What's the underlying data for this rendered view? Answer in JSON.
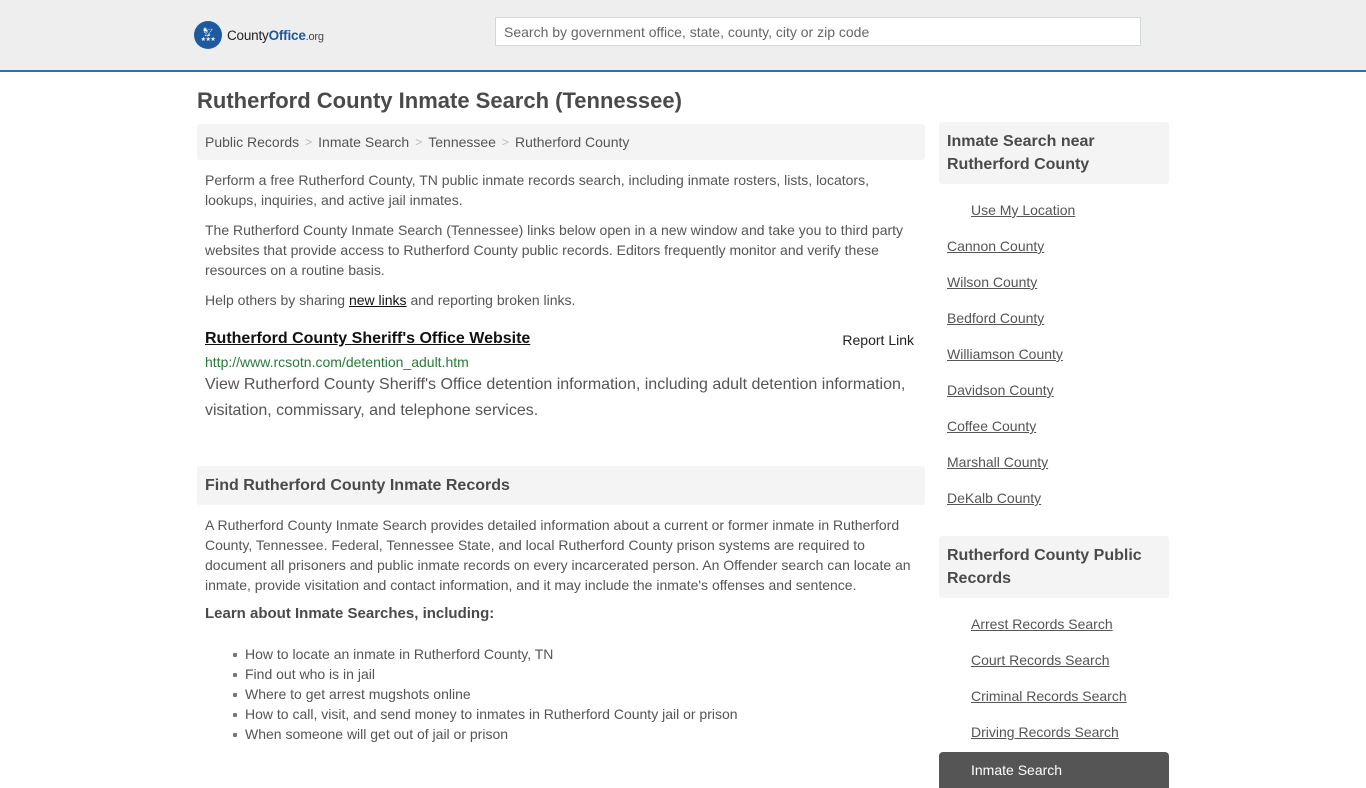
{
  "header": {
    "logo": {
      "name": "County",
      "office": "Office",
      "tld": ".org",
      "icon": "eagle-stars-badge"
    },
    "search_placeholder": "Search by government office, state, county, city or zip code",
    "search_value": ""
  },
  "colors": {
    "brand": "#1d5aa0",
    "header_border": "#2f6fb3",
    "url_green": "#2a7a3a",
    "active_item": "#555555"
  },
  "page": {
    "title": "Rutherford County Inmate Search (Tennessee)",
    "breadcrumb": [
      "Public Records",
      "Inmate Search",
      "Tennessee",
      "Rutherford County"
    ],
    "breadcrumb_separator": ">",
    "intro": "Perform a free Rutherford County, TN public inmate records search, including inmate rosters, lists, locators, lookups, inquiries, and active jail inmates.",
    "disclaimer": "The Rutherford County Inmate Search (Tennessee) links below open in a new window and take you to third party websites that provide access to Rutherford County public records. Editors frequently monitor and verify these resources on a routine basis.",
    "help": {
      "before": "Help others by sharing ",
      "link": "new links",
      "after": " and reporting broken links."
    },
    "resources": [
      {
        "title": "Rutherford County Sheriff's Office Website",
        "report_label": "Report Link",
        "url": "http://www.rcsotn.com/detention_adult.htm",
        "description": "View Rutherford County Sheriff's Office detention information, including adult detention information, visitation, commissary, and telephone services."
      }
    ],
    "find_section": {
      "heading": "Find Rutherford County Inmate Records",
      "body": "A Rutherford County Inmate Search provides detailed information about a current or former inmate in Rutherford County, Tennessee. Federal, Tennessee State, and local Rutherford County prison systems are required to document all prisoners and public inmate records on every incarcerated person. An Offender search can locate an inmate, provide visitation and contact information, and it may include the inmate's offenses and sentence.",
      "learn_heading": "Learn about Inmate Searches, including:",
      "bullets": [
        "How to locate an inmate in Rutherford County, TN",
        "Find out who is in jail",
        "Where to get arrest mugshots online",
        "How to call, visit, and send money to inmates in Rutherford County jail or prison",
        "When someone will get out of jail or prison"
      ]
    }
  },
  "sidebar": {
    "nearby": {
      "heading": "Inmate Search near Rutherford County",
      "use_location": "Use My Location",
      "counties": [
        "Cannon County",
        "Wilson County",
        "Bedford County",
        "Williamson County",
        "Davidson County",
        "Coffee County",
        "Marshall County",
        "DeKalb County"
      ]
    },
    "public_records": {
      "heading": "Rutherford County Public Records",
      "items": [
        "Arrest Records Search",
        "Court Records Search",
        "Criminal Records Search",
        "Driving Records Search",
        "Inmate Search"
      ],
      "active": "Inmate Search"
    }
  }
}
